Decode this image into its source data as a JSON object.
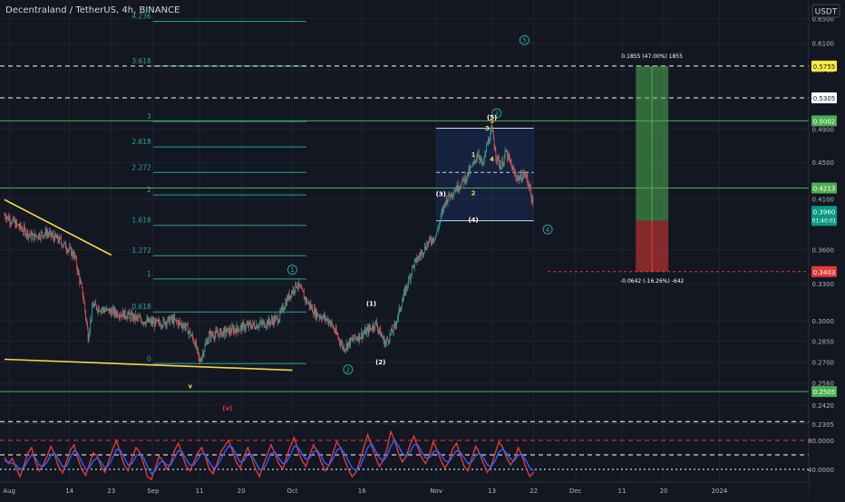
{
  "header": {
    "symbol_line": "Decentraland / TetherUS, 4h, BINANCE",
    "currency_badge": "USDT"
  },
  "chart_data": {
    "type": "candlestick",
    "title": "Decentraland / TetherUS, 4h, BINANCE",
    "quote_currency": "USDT",
    "scale": "log",
    "ylim": [
      0.2305,
      0.675
    ],
    "price_ticks": [
      "0.6500",
      "0.6100",
      "0.5700",
      "0.5305",
      "0.4900",
      "0.4500",
      "0.4100",
      "0.3600",
      "0.3300",
      "0.3000",
      "0.2850",
      "0.2700",
      "0.2560",
      "0.2420",
      "0.2305"
    ],
    "date_ticks": [
      "Aug",
      "14",
      "23",
      "Sep",
      "11",
      "20",
      "Oct",
      "16",
      "Nov",
      "13",
      "22",
      "Dec",
      "11",
      "20",
      "2024"
    ],
    "date_tick_dates": [
      "2023-08-01",
      "2023-08-14",
      "2023-08-23",
      "2023-09-01",
      "2023-09-11",
      "2023-09-20",
      "2023-10-01",
      "2023-10-16",
      "2023-11-01",
      "2023-11-13",
      "2023-11-22",
      "2023-12-01",
      "2023-12-11",
      "2023-12-20",
      "2024-01-01"
    ],
    "price_path": [
      [
        "2023-07-31",
        0.3935
      ],
      [
        "2023-08-03",
        0.382
      ],
      [
        "2023-08-06",
        0.372
      ],
      [
        "2023-08-09",
        0.376
      ],
      [
        "2023-08-12",
        0.368
      ],
      [
        "2023-08-15",
        0.355
      ],
      [
        "2023-08-17",
        0.318
      ],
      [
        "2023-08-18",
        0.288
      ],
      [
        "2023-08-19",
        0.312
      ],
      [
        "2023-08-22",
        0.308
      ],
      [
        "2023-08-26",
        0.305
      ],
      [
        "2023-08-30",
        0.3
      ],
      [
        "2023-09-02",
        0.298
      ],
      [
        "2023-09-05",
        0.301
      ],
      [
        "2023-09-08",
        0.296
      ],
      [
        "2023-09-10",
        0.284
      ],
      [
        "2023-09-11",
        0.27
      ],
      [
        "2023-09-13",
        0.289
      ],
      [
        "2023-09-17",
        0.292
      ],
      [
        "2023-09-21",
        0.296
      ],
      [
        "2023-09-25",
        0.298
      ],
      [
        "2023-09-28",
        0.302
      ],
      [
        "2023-09-30",
        0.318
      ],
      [
        "2023-10-02",
        0.33
      ],
      [
        "2023-10-04",
        0.316
      ],
      [
        "2023-10-06",
        0.306
      ],
      [
        "2023-10-09",
        0.3
      ],
      [
        "2023-10-12",
        0.28
      ],
      [
        "2023-10-14",
        0.286
      ],
      [
        "2023-10-17",
        0.292
      ],
      [
        "2023-10-19",
        0.298
      ],
      [
        "2023-10-21",
        0.283
      ],
      [
        "2023-10-23",
        0.295
      ],
      [
        "2023-10-25",
        0.32
      ],
      [
        "2023-10-27",
        0.345
      ],
      [
        "2023-10-30",
        0.365
      ],
      [
        "2023-11-01",
        0.374
      ],
      [
        "2023-11-03",
        0.408
      ],
      [
        "2023-11-05",
        0.42
      ],
      [
        "2023-11-07",
        0.43
      ],
      [
        "2023-11-09",
        0.447
      ],
      [
        "2023-11-10",
        0.462
      ],
      [
        "2023-11-11",
        0.445
      ],
      [
        "2023-11-12",
        0.472
      ],
      [
        "2023-11-13",
        0.488
      ],
      [
        "2023-11-14",
        0.455
      ],
      [
        "2023-11-15",
        0.445
      ],
      [
        "2023-11-16",
        0.462
      ],
      [
        "2023-11-17",
        0.448
      ],
      [
        "2023-11-18",
        0.435
      ],
      [
        "2023-11-19",
        0.432
      ],
      [
        "2023-11-20",
        0.437
      ],
      [
        "2023-11-21",
        0.425
      ],
      [
        "2023-11-22",
        0.396
      ]
    ],
    "current_price": "0.3960",
    "countdown": "01:40:01",
    "horizontal_levels": [
      {
        "price": 0.5755,
        "label": "0.5755",
        "style": "dashed",
        "color": "#ffffff"
      },
      {
        "price": 0.5305,
        "label": "0.5305",
        "style": "dashed",
        "color": "#ffffff"
      },
      {
        "price": 0.5002,
        "label": "0.5002",
        "style": "solid",
        "color": "#4caf50"
      },
      {
        "price": 0.4213,
        "label": "0.4213",
        "style": "solid",
        "color": "#4caf50"
      },
      {
        "price": 0.2505,
        "label": "0.2505",
        "style": "solid",
        "color": "#4caf50"
      },
      {
        "price": 0.232,
        "label": "",
        "style": "dashed",
        "color": "#ffffff"
      }
    ],
    "fib_extension": {
      "start_date": "2023-09-01",
      "end_date": "2023-10-04",
      "color": "#26a69a",
      "levels": [
        {
          "label": "4.236",
          "price": 0.645
        },
        {
          "label": "3.618",
          "price": 0.5755
        },
        {
          "label": "3",
          "price": 0.4995
        },
        {
          "label": "2.618",
          "price": 0.468
        },
        {
          "label": "2.272",
          "price": 0.4385
        },
        {
          "label": "2",
          "price": 0.414
        },
        {
          "label": "1.618",
          "price": 0.383
        },
        {
          "label": "1.272",
          "price": 0.3545
        },
        {
          "label": "1",
          "price": 0.334
        },
        {
          "label": "0.618",
          "price": 0.307
        },
        {
          "label": "0",
          "price": 0.269
        }
      ]
    },
    "wave_box": {
      "start_date": "2023-11-01",
      "end_date": "2023-11-22",
      "top": 0.491,
      "bottom": 0.3875,
      "color": "#2962ff"
    },
    "wave_box_lines": [
      {
        "price": 0.491,
        "style": "solid"
      },
      {
        "price": 0.4385,
        "style": "dashed"
      },
      {
        "price": 0.3875,
        "style": "solid"
      }
    ],
    "trendlines": [
      {
        "from": [
          "2023-07-31",
          0.409
        ],
        "to": [
          "2023-08-23",
          0.355
        ],
        "color": "#f5d742"
      },
      {
        "from": [
          "2023-07-31",
          0.272
        ],
        "to": [
          "2023-10-01",
          0.2645
        ],
        "color": "#f5d742"
      }
    ],
    "wave_labels": [
      {
        "text": "1",
        "date": "2023-10-01",
        "price": 0.342,
        "circled": true,
        "color": "#26a69a"
      },
      {
        "text": "2",
        "date": "2023-10-13",
        "price": 0.265,
        "circled": true,
        "color": "#26a69a"
      },
      {
        "text": "3",
        "date": "2023-11-14",
        "price": 0.51,
        "circled": true,
        "color": "#26a69a"
      },
      {
        "text": "4",
        "date": "2023-11-25",
        "price": 0.379,
        "circled": true,
        "color": "#26a69a"
      },
      {
        "text": "5",
        "date": "2023-11-20",
        "price": 0.615,
        "circled": true,
        "color": "#26a69a"
      },
      {
        "text": "(1)",
        "date": "2023-10-18",
        "price": 0.3135,
        "circled": false,
        "color": "#ffffff"
      },
      {
        "text": "(2)",
        "date": "2023-10-20",
        "price": 0.27,
        "circled": false,
        "color": "#ffffff"
      },
      {
        "text": "(3)",
        "date": "2023-11-02",
        "price": 0.415,
        "circled": false,
        "color": "#ffffff"
      },
      {
        "text": "(4)",
        "date": "2023-11-09",
        "price": 0.3885,
        "circled": false,
        "color": "#ffffff"
      },
      {
        "text": "(5)",
        "date": "2023-11-13",
        "price": 0.505,
        "circled": false,
        "color": "#ffffff"
      },
      {
        "text": "1",
        "date": "2023-11-09",
        "price": 0.459,
        "circled": false,
        "color": "#f5d742"
      },
      {
        "text": "2",
        "date": "2023-11-09",
        "price": 0.416,
        "circled": false,
        "color": "#f5d742"
      },
      {
        "text": "3",
        "date": "2023-11-12",
        "price": 0.491,
        "circled": false,
        "color": "#f5d742"
      },
      {
        "text": "4",
        "date": "2023-11-13",
        "price": 0.454,
        "circled": false,
        "color": "#f5d742"
      },
      {
        "text": "5",
        "date": "2023-11-13",
        "price": 0.5,
        "circled": false,
        "color": "#f5d742"
      },
      {
        "text": "v",
        "date": "2023-09-09",
        "price": 0.254,
        "circled": false,
        "color": "#f5d742"
      },
      {
        "text": "(v)",
        "date": "2023-09-17",
        "price": 0.24,
        "circled": false,
        "color": "#e53935"
      }
    ],
    "position": {
      "start_date": "2023-12-14",
      "end_date": "2023-12-21",
      "entry": 0.3875,
      "target": 0.5755,
      "stop": 0.3403,
      "target_label": "0.1855 (47.00%) 1855",
      "stop_label": "-0.0642 (-16.26%) -642",
      "stop_price_label": "0.3403",
      "profit_color": "#4caf50",
      "loss_color": "#e53935"
    },
    "red_dotted_level": {
      "price": 0.3403,
      "start_date": "2023-11-25"
    },
    "oscillator": {
      "ticks": [
        "80.0000",
        "40.0000"
      ],
      "ylim": [
        25,
        100
      ],
      "levels": [
        {
          "value": 80,
          "color": "#e53935",
          "style": "dashed"
        },
        {
          "value": 60,
          "color": "#ffffff",
          "style": "dashed"
        },
        {
          "value": 40,
          "color": "#ffffff",
          "style": "dotted"
        }
      ],
      "series": [
        {
          "name": "",
          "color": "#e53935",
          "values": [
            56,
            48,
            55,
            42,
            30,
            45,
            62,
            70,
            50,
            38,
            46,
            58,
            72,
            60,
            44,
            35,
            50,
            66,
            74,
            55,
            40,
            32,
            48,
            63,
            58,
            44,
            36,
            52,
            68,
            80,
            62,
            46,
            38,
            55,
            70,
            64,
            48,
            30,
            26,
            42,
            58,
            52,
            40,
            48,
            66,
            76,
            60,
            45,
            38,
            50,
            62,
            70,
            58,
            40,
            34,
            48,
            64,
            72,
            80,
            66,
            50,
            42,
            58,
            70,
            55,
            40,
            30,
            46,
            60,
            74,
            62,
            48,
            40,
            56,
            72,
            84,
            66,
            52,
            44,
            60,
            74,
            64,
            50,
            38,
            46,
            62,
            78,
            70,
            54,
            40,
            30,
            36,
            52,
            70,
            88,
            74,
            58,
            44,
            52,
            68,
            92,
            80,
            62,
            50,
            58,
            74,
            86,
            70,
            56,
            48,
            60,
            78,
            66,
            52,
            42,
            50,
            68,
            76,
            60,
            44,
            38,
            56,
            72,
            62,
            48,
            36,
            44,
            62,
            78,
            70,
            56,
            46,
            54,
            70,
            58,
            42,
            30,
            36
          ]
        },
        {
          "name": "",
          "color": "#2962ff",
          "values": [
            52,
            50,
            48,
            46,
            40,
            42,
            52,
            60,
            56,
            46,
            44,
            50,
            60,
            62,
            54,
            44,
            44,
            56,
            66,
            62,
            50,
            40,
            42,
            52,
            56,
            50,
            42,
            46,
            56,
            68,
            66,
            56,
            46,
            48,
            58,
            62,
            56,
            44,
            34,
            38,
            48,
            52,
            46,
            46,
            56,
            66,
            64,
            54,
            46,
            46,
            54,
            62,
            60,
            50,
            42,
            44,
            54,
            64,
            72,
            70,
            60,
            50,
            52,
            62,
            60,
            50,
            40,
            40,
            50,
            62,
            64,
            56,
            48,
            50,
            60,
            72,
            70,
            62,
            54,
            56,
            64,
            66,
            58,
            48,
            46,
            54,
            66,
            70,
            62,
            52,
            42,
            38,
            44,
            56,
            70,
            76,
            66,
            56,
            52,
            58,
            72,
            80,
            72,
            62,
            58,
            64,
            74,
            74,
            64,
            56,
            56,
            64,
            66,
            60,
            52,
            50,
            58,
            66,
            64,
            56,
            48,
            50,
            60,
            62,
            56,
            46,
            44,
            52,
            64,
            68,
            62,
            54,
            52,
            60,
            60,
            52,
            42,
            38
          ]
        }
      ]
    }
  }
}
